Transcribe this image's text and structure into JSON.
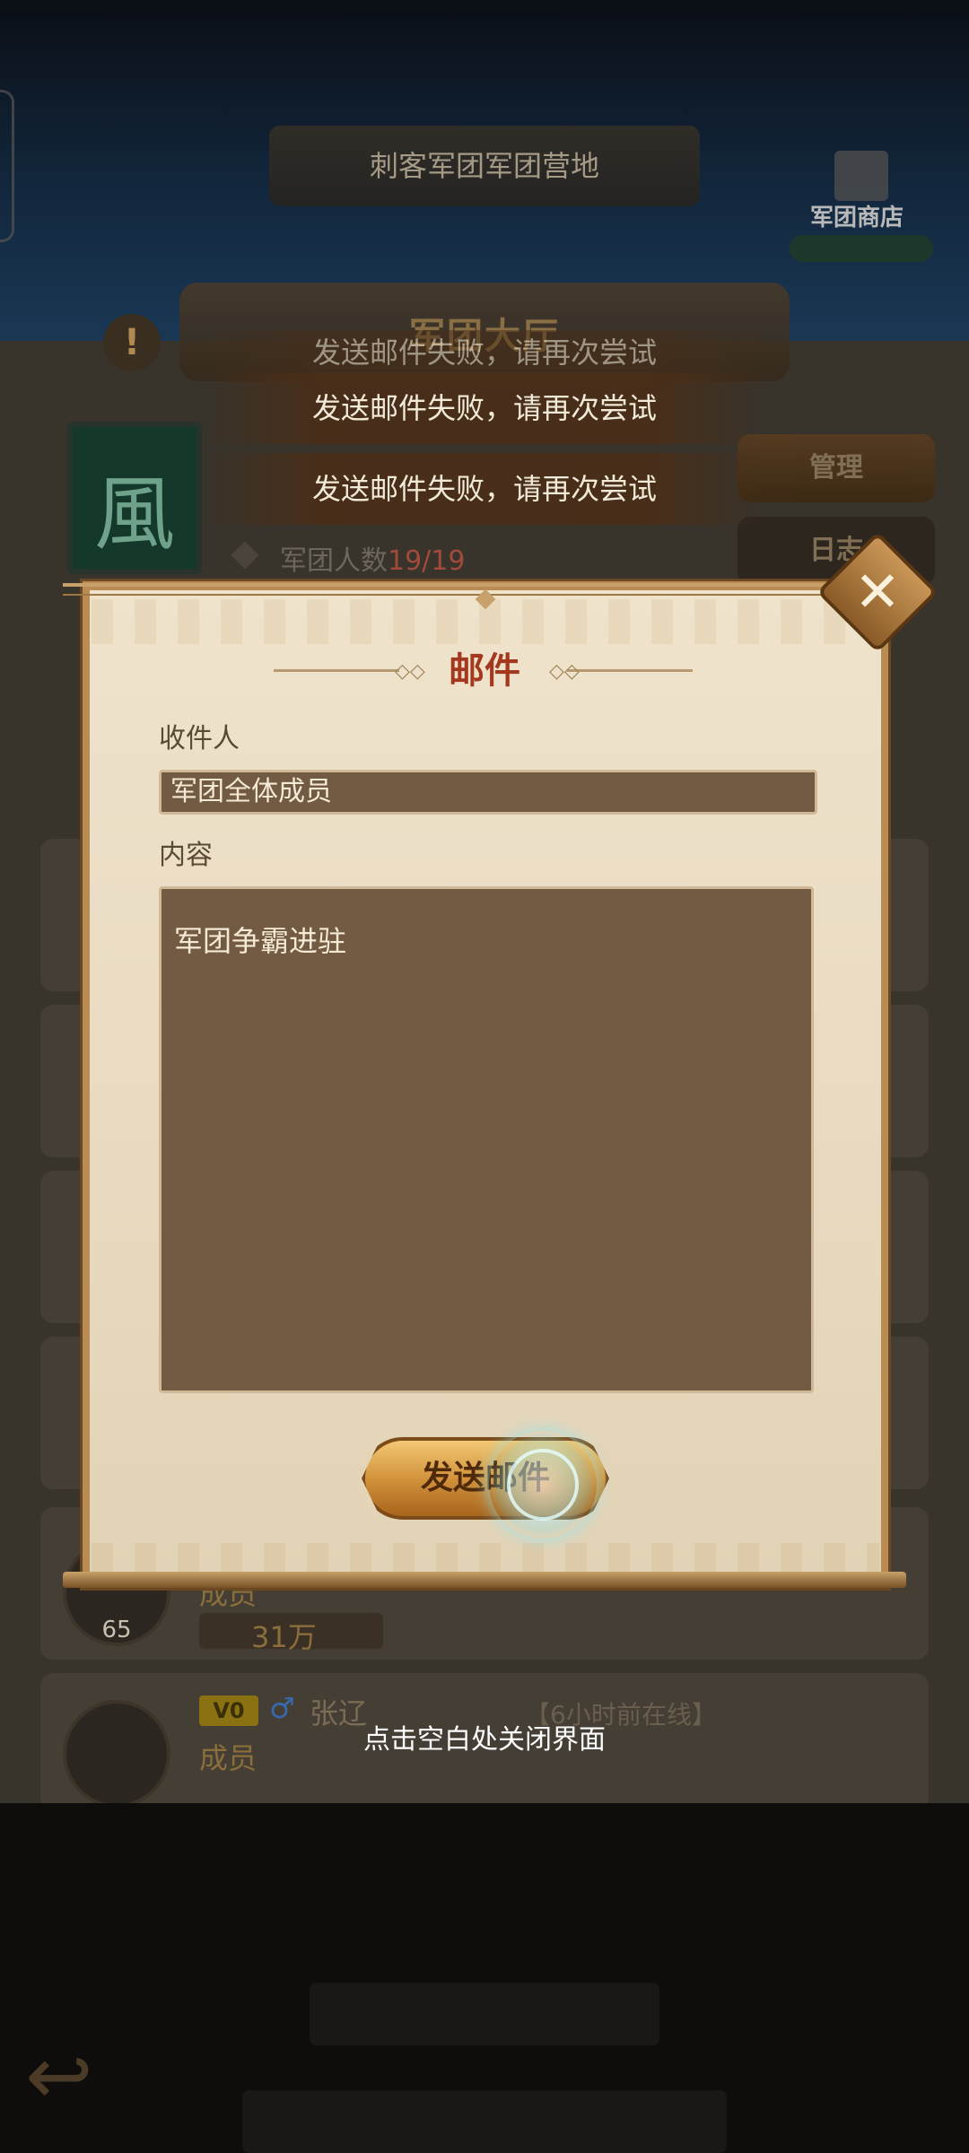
{
  "background": {
    "top_title": "刺客军团军团营地",
    "shop_label": "军团商店",
    "hall_title": "军团大厅",
    "alert_icon": "alert-icon",
    "guild_flag_char": "風",
    "member_count_label": "军团人数",
    "member_count_value": "19/19",
    "side_buttons": [
      "管理",
      "日志"
    ],
    "member_row_5": {
      "level": "65",
      "role": "成员",
      "power": "31万"
    },
    "member_row_6": {
      "vip": "V0",
      "gender_icon": "male-icon",
      "gender_glyph": "♂",
      "name": "张辽",
      "online_status": "【6小时前在线】",
      "role": "成员"
    }
  },
  "toasts": [
    "发送邮件失败，请再次尝试",
    "发送邮件失败，请再次尝试",
    "发送邮件失败，请再次尝试"
  ],
  "mail_dialog": {
    "title": "邮件",
    "recipient_label": "收件人",
    "recipient_value": "军团全体成员",
    "content_label": "内容",
    "content_value": "军团争霸进驻",
    "send_button": "发送邮件",
    "close_glyph": "✕"
  },
  "close_hint": "点击空白处关闭界面",
  "colors": {
    "dialog_bg": "#efe3cc",
    "field_bg": "#735a42",
    "title_red": "#a3381e",
    "button_gold": "#d3933c",
    "member_count_red": "#a04b3a"
  }
}
